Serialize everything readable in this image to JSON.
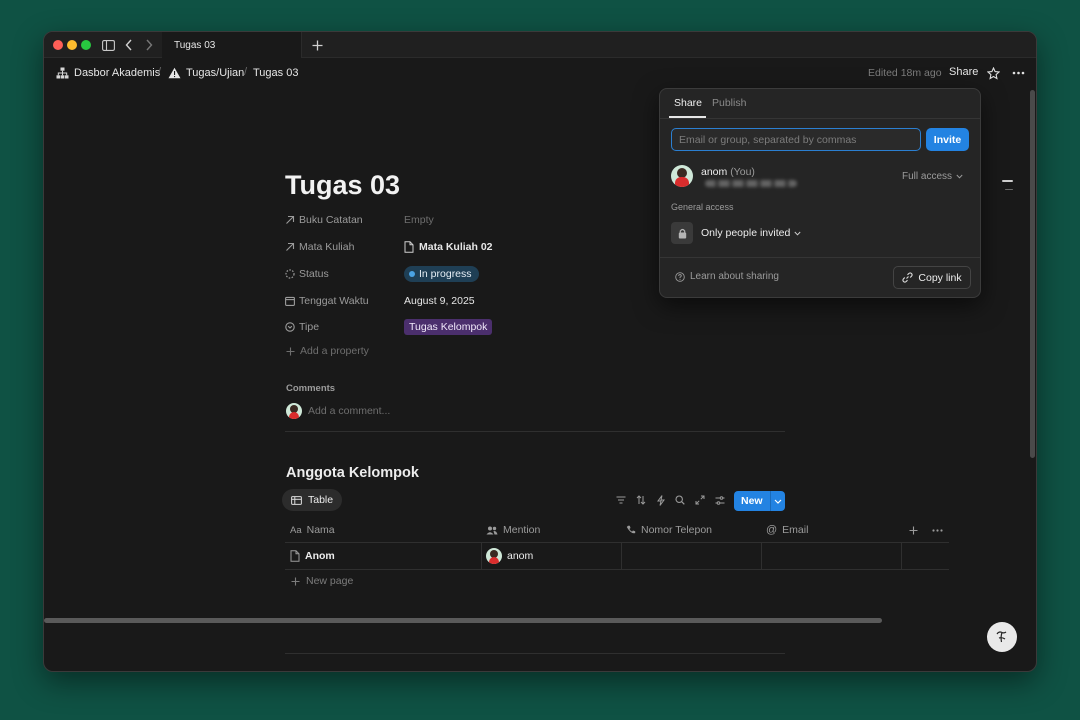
{
  "tab": {
    "title": "Tugas 03"
  },
  "breadcrumbs": [
    {
      "label": "Dasbor Akademis",
      "icon": "org-chart-icon"
    },
    {
      "label": "Tugas/Ujian",
      "icon": "warning-icon"
    },
    {
      "label": "Tugas 03",
      "icon": ""
    }
  ],
  "header": {
    "edited": "Edited 18m ago",
    "share": "Share"
  },
  "page": {
    "title": "Tugas 03",
    "properties": [
      {
        "name": "Buku Catatan",
        "icon": "arrow-up-right-icon",
        "value": "Empty"
      },
      {
        "name": "Mata Kuliah",
        "icon": "arrow-up-right-icon",
        "value": "Mata Kuliah 02"
      },
      {
        "name": "Status",
        "icon": "status-icon",
        "value": "In progress"
      },
      {
        "name": "Tenggat Waktu",
        "icon": "calendar-icon",
        "value": "August 9, 2025"
      },
      {
        "name": "Tipe",
        "icon": "select-icon",
        "value": "Tugas Kelompok"
      }
    ],
    "add_property": "Add a property",
    "comments_label": "Comments",
    "comment_placeholder": "Add a comment...",
    "section_title": "Anggota Kelompok",
    "view_tab": "Table",
    "new_button": "New",
    "columns": [
      "Nama",
      "Mention",
      "Nomor Telepon",
      "Email"
    ],
    "rows": [
      {
        "nama": "Anom",
        "mention": "anom",
        "phone": "",
        "email": ""
      }
    ],
    "new_page": "New page"
  },
  "share_popup": {
    "tabs": [
      "Share",
      "Publish"
    ],
    "email_placeholder": "Email or group, separated by commas",
    "invite": "Invite",
    "user": {
      "name": "anom",
      "you": "(You)",
      "access": "Full access"
    },
    "general_access_label": "General access",
    "general_access_value": "Only people invited",
    "learn": "Learn about sharing",
    "copy_link": "Copy link"
  },
  "colors": {
    "accent": "#2383e2",
    "status_badge": "#1f3f55",
    "tipe_badge": "#4b2f6d",
    "background": "#0f5244"
  }
}
